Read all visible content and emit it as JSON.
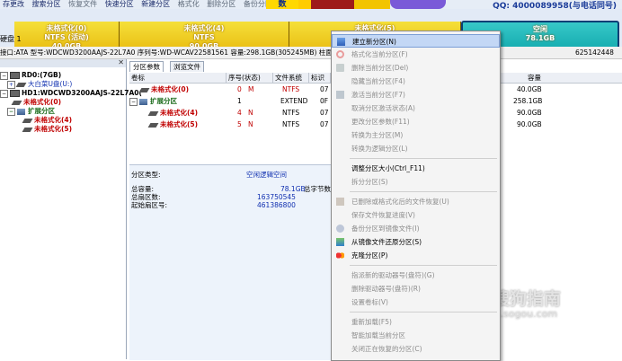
{
  "toolbar": {
    "items": [
      "存更改",
      "搜索分区",
      "恢复文件",
      "快速分区",
      "新建分区",
      "格式化",
      "删除分区",
      "备份分区"
    ],
    "qq": "QQ: 4000089958(与电话同号)",
    "banner_text": "数"
  },
  "disk_label": "硬盘 1",
  "segments": [
    {
      "name": "未格式化(0)",
      "fs": "NTFS (活动)",
      "size": "40.0GB"
    },
    {
      "name": "未格式化(4)",
      "fs": "NTFS",
      "size": "90.0GB"
    },
    {
      "name": "未格式化(5)",
      "fs": "NTFS",
      "size": "90.0GB"
    },
    {
      "name": "空闲",
      "fs": "",
      "size": "78.1GB"
    }
  ],
  "info_line": {
    "left": "接口:ATA  型号:WDCWD3200AAJS-22L7A0  序列号:WD-WCAV22581561  容量:298.1GB(305245MB)  柱面数",
    "right": "625142448"
  },
  "tree": {
    "nodes": [
      {
        "label": "RD0:(7GB)",
        "style": "bold"
      },
      {
        "label": "大白菜U盘(U:)",
        "style": "blue"
      },
      {
        "label": "HD1:WDCWD3200AAJS-22L7A0(",
        "style": "bold"
      },
      {
        "label": "未格式化(0)",
        "style": "red"
      },
      {
        "label": "扩展分区",
        "style": "green"
      },
      {
        "label": "未格式化(4)",
        "style": "red"
      },
      {
        "label": "未格式化(5)",
        "style": "red"
      }
    ]
  },
  "tabs": [
    "分区参数",
    "浏览文件"
  ],
  "table": {
    "columns": [
      "卷标",
      "序号(状态)",
      "文件系统",
      "标识"
    ],
    "rows": [
      {
        "label": "未格式化(0)",
        "num": "0",
        "status": "M",
        "fs": "NTFS",
        "id": "07"
      },
      {
        "label": "扩展分区",
        "num": "1",
        "status": "",
        "fs": "EXTEND",
        "id": "0F"
      },
      {
        "label": "未格式化(4)",
        "num": "4",
        "status": "N",
        "fs": "NTFS",
        "id": "07"
      },
      {
        "label": "未格式化(5)",
        "num": "5",
        "status": "N",
        "fs": "NTFS",
        "id": "07"
      }
    ],
    "right_header": "容量",
    "right_values": [
      "40.0GB",
      "258.1GB",
      "90.0GB",
      "90.0GB"
    ]
  },
  "details": {
    "type_label": "分区类型:",
    "type_value": "空闲逻辑空间",
    "total_label": "总容量:",
    "total_value": "78.1GB",
    "bytes_label": "总字节数",
    "sectors_label": "总扇区数:",
    "sectors_value": "163750545",
    "start_label": "起始扇区号:",
    "start_value": "461386800"
  },
  "menu": {
    "items": [
      {
        "label": "建立新分区(N)",
        "enabled": true,
        "highlight": true,
        "icon": "new-partition-icon"
      },
      {
        "label": "格式化当前分区(F)",
        "enabled": false,
        "icon": "format-icon"
      },
      {
        "label": "删除当前分区(Del)",
        "enabled": false,
        "icon": "delete-icon"
      },
      {
        "label": "隐藏当前分区(F4)",
        "enabled": false,
        "icon": ""
      },
      {
        "label": "激活当前分区(F7)",
        "enabled": false,
        "icon": "activate-icon"
      },
      {
        "label": "取消分区激活状态(A)",
        "enabled": false,
        "icon": ""
      },
      {
        "label": "更改分区参数(F11)",
        "enabled": false,
        "icon": ""
      },
      {
        "label": "转换为主分区(M)",
        "enabled": false,
        "icon": ""
      },
      {
        "label": "转换为逻辑分区(L)",
        "enabled": false,
        "icon": ""
      },
      {
        "sep": true
      },
      {
        "label": "调整分区大小(Ctrl_F11)",
        "enabled": true,
        "icon": ""
      },
      {
        "label": "拆分分区(S)",
        "enabled": false,
        "icon": ""
      },
      {
        "sep": true
      },
      {
        "label": "已删除或格式化后的文件恢复(U)",
        "enabled": false,
        "icon": "recover-icon"
      },
      {
        "label": "保存文件恢复进度(V)",
        "enabled": false,
        "icon": ""
      },
      {
        "label": "备份分区到镜像文件(I)",
        "enabled": false,
        "icon": "backup-icon"
      },
      {
        "label": "从镜像文件还原分区(S)",
        "enabled": true,
        "icon": "restore-icon"
      },
      {
        "label": "克隆分区(P)",
        "enabled": true,
        "icon": "clone-icon"
      },
      {
        "sep": true
      },
      {
        "label": "指派新的驱动器号(盘符)(G)",
        "enabled": false,
        "icon": ""
      },
      {
        "label": "删除驱动器号(盘符)(R)",
        "enabled": false,
        "icon": ""
      },
      {
        "label": "设置卷标(V)",
        "enabled": false,
        "icon": ""
      },
      {
        "sep": true
      },
      {
        "label": "重新加载(F5)",
        "enabled": false,
        "icon": ""
      },
      {
        "label": "智能加载当前分区",
        "enabled": false,
        "icon": ""
      },
      {
        "label": "关闭正在恢复的分区(C)",
        "enabled": false,
        "icon": ""
      }
    ]
  },
  "watermark": {
    "text": "搜狗指南",
    "url": "zhinan.sogou.com"
  },
  "colors": {
    "partition_yellow": "#e8b90d",
    "free_cyan": "#0fa7ab",
    "menu_highlight": "#c3d7f5"
  }
}
